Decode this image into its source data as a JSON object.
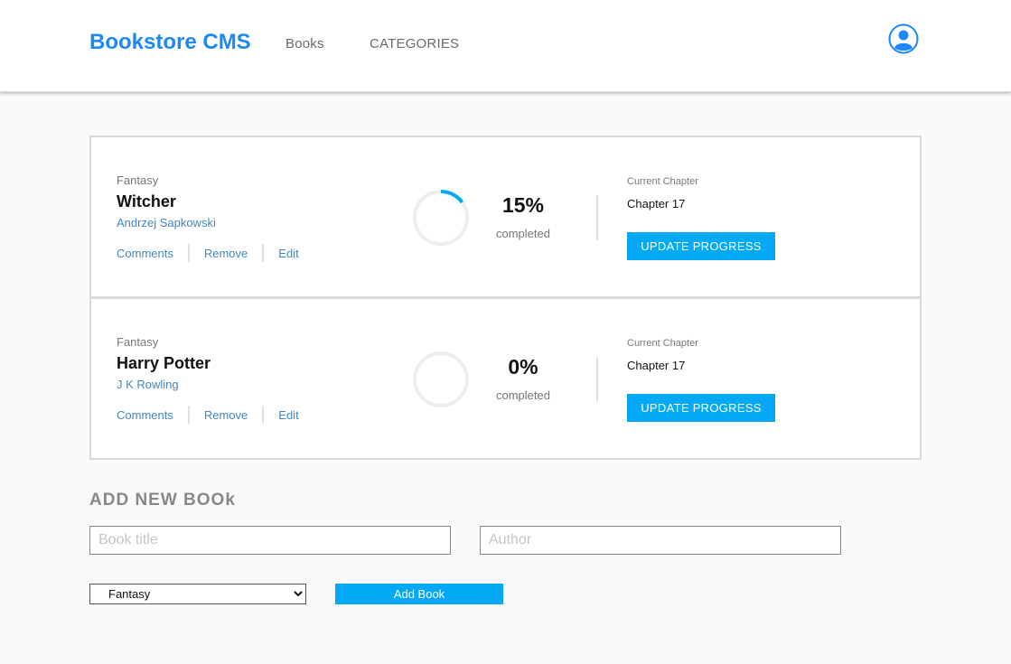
{
  "header": {
    "brand": "Bookstore CMS",
    "nav": [
      {
        "label": "Books"
      },
      {
        "label": "CATEGORIES"
      }
    ],
    "user_icon": "user-icon"
  },
  "books": [
    {
      "genre": "Fantasy",
      "title": "Witcher",
      "author": "Andrzej Sapkowski",
      "actions": [
        "Comments",
        "Remove",
        "Edit"
      ],
      "progress": 15,
      "percent_label": "15%",
      "completed_label": "completed",
      "chapter_label": "Current Chapter",
      "chapter": "Chapter 17",
      "update_label": "UPDATE PROGRESS"
    },
    {
      "genre": "Fantasy",
      "title": "Harry Potter",
      "author": "J K Rowling",
      "actions": [
        "Comments",
        "Remove",
        "Edit"
      ],
      "progress": 0,
      "percent_label": "0%",
      "completed_label": "completed",
      "chapter_label": "Current Chapter",
      "chapter": "Chapter 17",
      "update_label": "UPDATE PROGRESS"
    }
  ],
  "form": {
    "heading": "ADD NEW BOOk",
    "title_placeholder": "Book title",
    "author_placeholder": "Author",
    "category_selected": "Fantasy",
    "submit_label": "Add Book"
  },
  "colors": {
    "brand": "#1e88f5",
    "accent": "#03a9f4",
    "link": "#4386bf",
    "ring_track": "#eeeeee"
  }
}
